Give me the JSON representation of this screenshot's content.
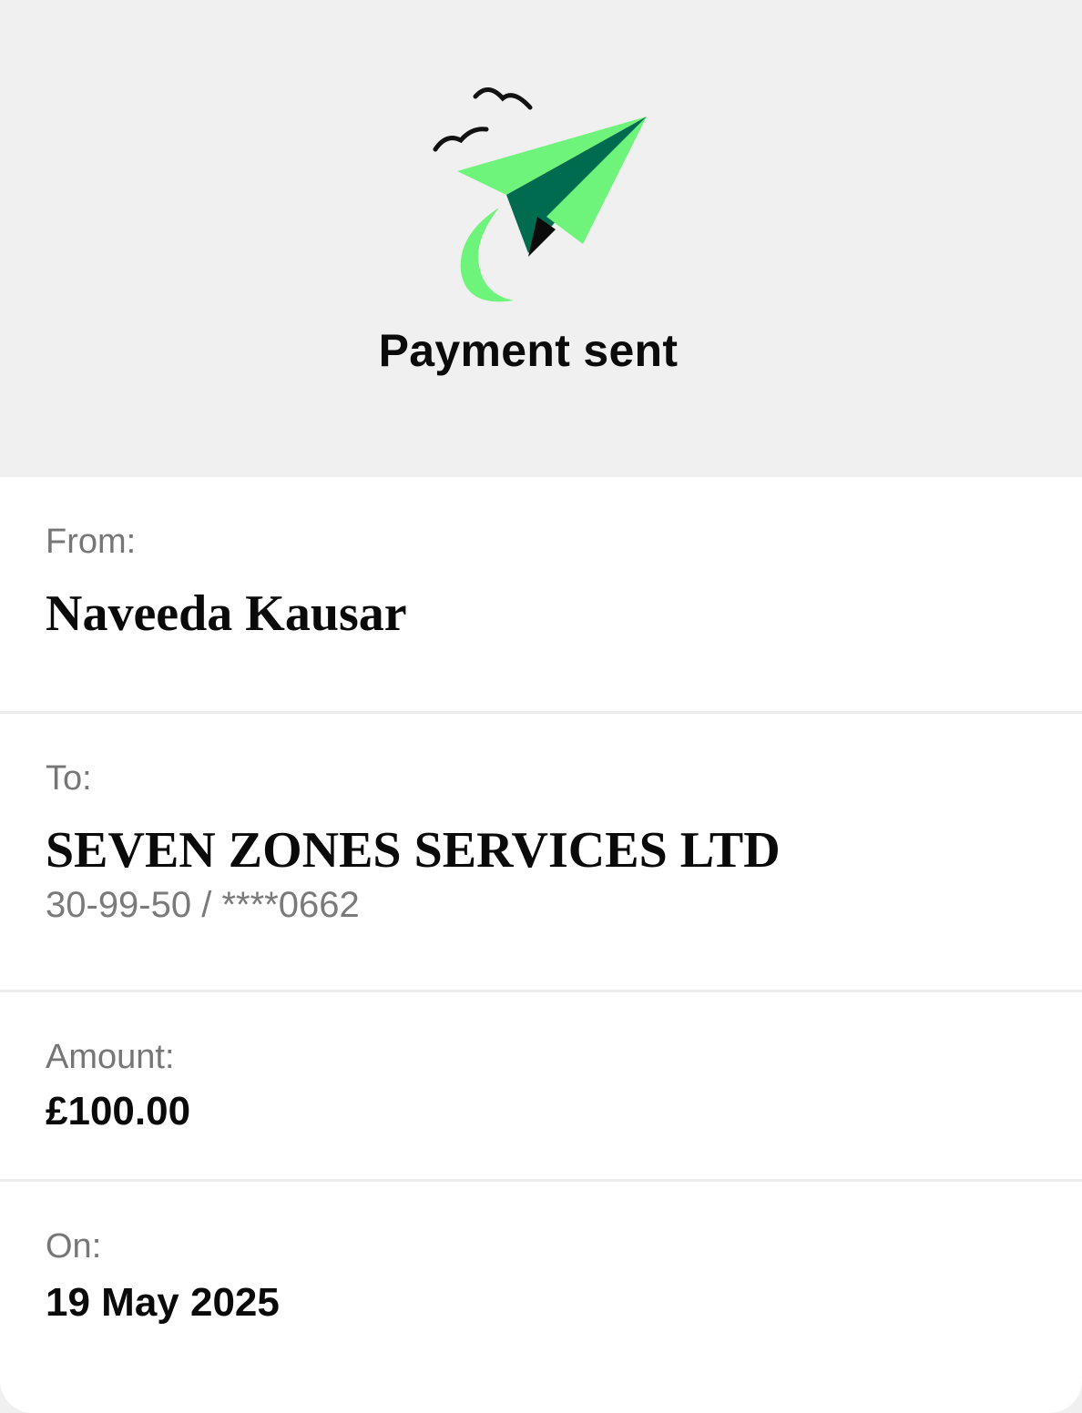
{
  "hero": {
    "title": "Payment sent",
    "illustration_icon": "paper-plane-icon",
    "colors": {
      "background": "#f0f0f0",
      "plane_light": "#6ef47a",
      "plane_dark": "#006b4f",
      "ink": "#111111"
    }
  },
  "details": {
    "from": {
      "label": "From:",
      "name": "Naveeda Kausar"
    },
    "to": {
      "label": "To:",
      "name": "SEVEN ZONES SERVICES LTD",
      "account": "30-99-50 / ****0662"
    },
    "amount": {
      "label": "Amount:",
      "value": "£100.00"
    },
    "date": {
      "label": "On:",
      "value": "19 May 2025"
    }
  }
}
